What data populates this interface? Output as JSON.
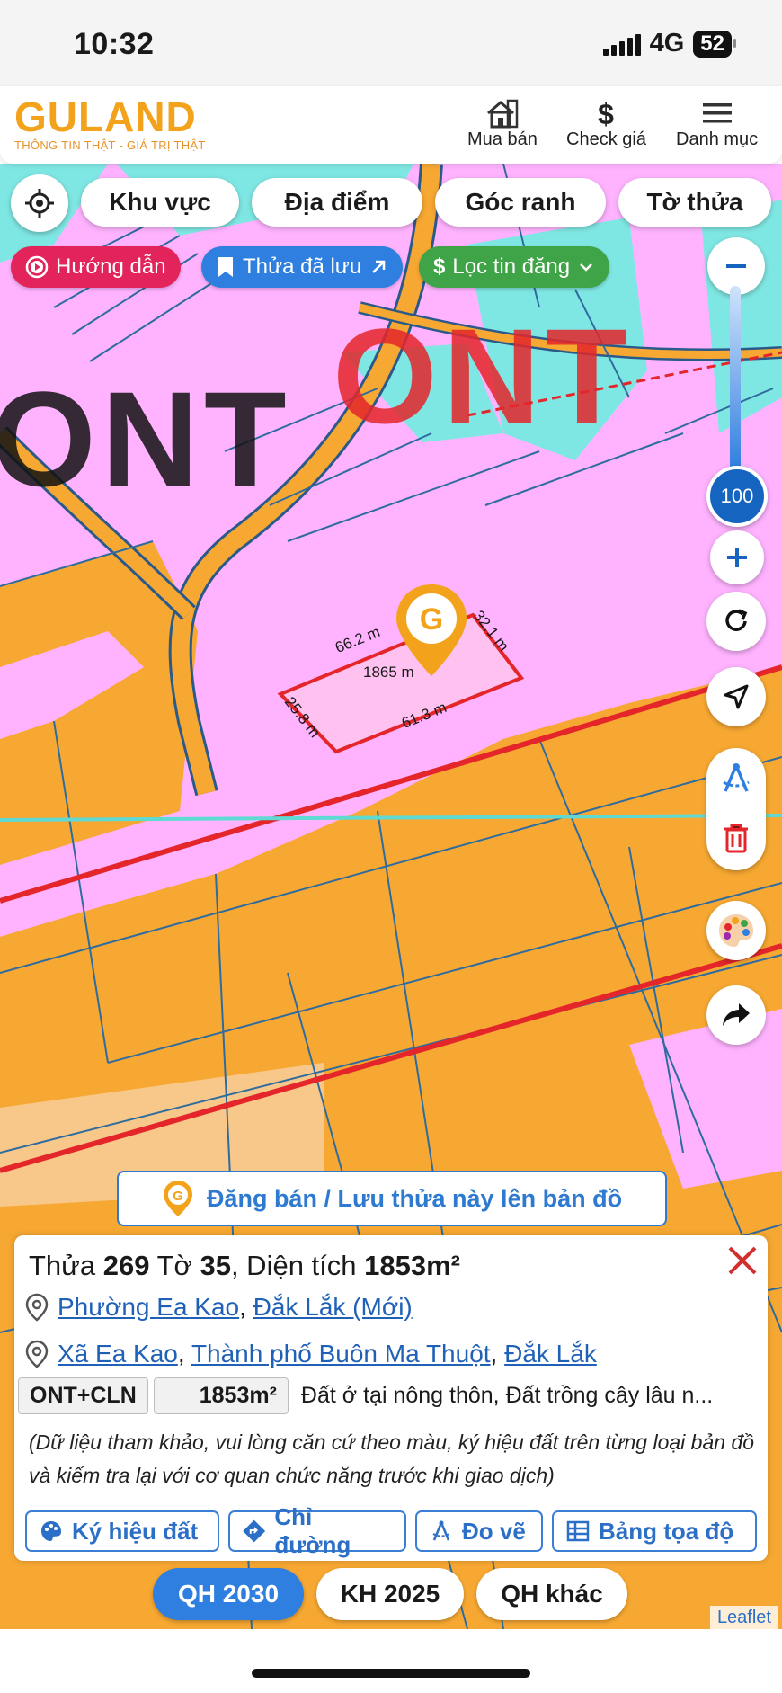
{
  "status_bar": {
    "time": "10:32",
    "network": "4G",
    "battery": "52"
  },
  "app": {
    "logo_text": "GULAND",
    "logo_tagline": "THÔNG TIN THẬT - GIÁ TRỊ THẬT",
    "nav": [
      {
        "label": "Mua bán",
        "icon": "house-icon"
      },
      {
        "label": "Check giá",
        "icon": "dollar-icon"
      },
      {
        "label": "Danh mục",
        "icon": "menu-icon"
      }
    ]
  },
  "filters": {
    "locate_icon": "crosshair-icon",
    "items": [
      "Khu vực",
      "Địa điểm",
      "Góc ranh",
      "Tờ thửa"
    ]
  },
  "chips": {
    "guide": "Hướng dẫn",
    "saved": "Thửa đã lưu",
    "filter_posts": "Lọc tin đăng",
    "colors": {
      "guide": "#e3245a",
      "saved": "#2f7fe0",
      "filter_posts": "#3fa447"
    }
  },
  "map_labels": {
    "zone_black": "ONT",
    "zone_red": "ONT"
  },
  "zoom": {
    "level": "100"
  },
  "parcel": {
    "edges": [
      "66.2 m",
      "32.1 m",
      "61.3 m",
      "25.8 m"
    ],
    "area_label": "1865 m"
  },
  "banner": {
    "label": "Đăng bán / Lưu thửa này lên bản đồ"
  },
  "info": {
    "title": {
      "prefix": "Thửa ",
      "parcel_no": "269",
      "sheet_prefix": " Tờ ",
      "sheet_no": "35",
      "area_prefix": ", Diện tích ",
      "area": "1853m²"
    },
    "new_location": {
      "ward": "Phường Ea Kao",
      "province": "Đắk Lắk (Mới)"
    },
    "old_location": {
      "commune": "Xã Ea Kao",
      "city": "Thành phố Buôn Ma Thuột",
      "province": "Đắk Lắk"
    },
    "land_code": "ONT+CLN",
    "land_area": "1853m²",
    "land_desc": "Đất ở tại nông thôn, Đất trồng cây lâu n...",
    "note": "(Dữ liệu tham khảo, vui lòng căn cứ theo màu, ký hiệu đất trên từng loại bản đồ và kiểm tra lại với cơ quan chức năng trước khi giao dịch)",
    "actions": [
      "Ký hiệu đất",
      "Chỉ đường",
      "Đo vẽ",
      "Bảng tọa độ"
    ]
  },
  "plan_tabs": {
    "items": [
      "QH 2030",
      "KH 2025",
      "QH khác"
    ],
    "active": "QH 2030"
  },
  "attribution": "Leaflet"
}
